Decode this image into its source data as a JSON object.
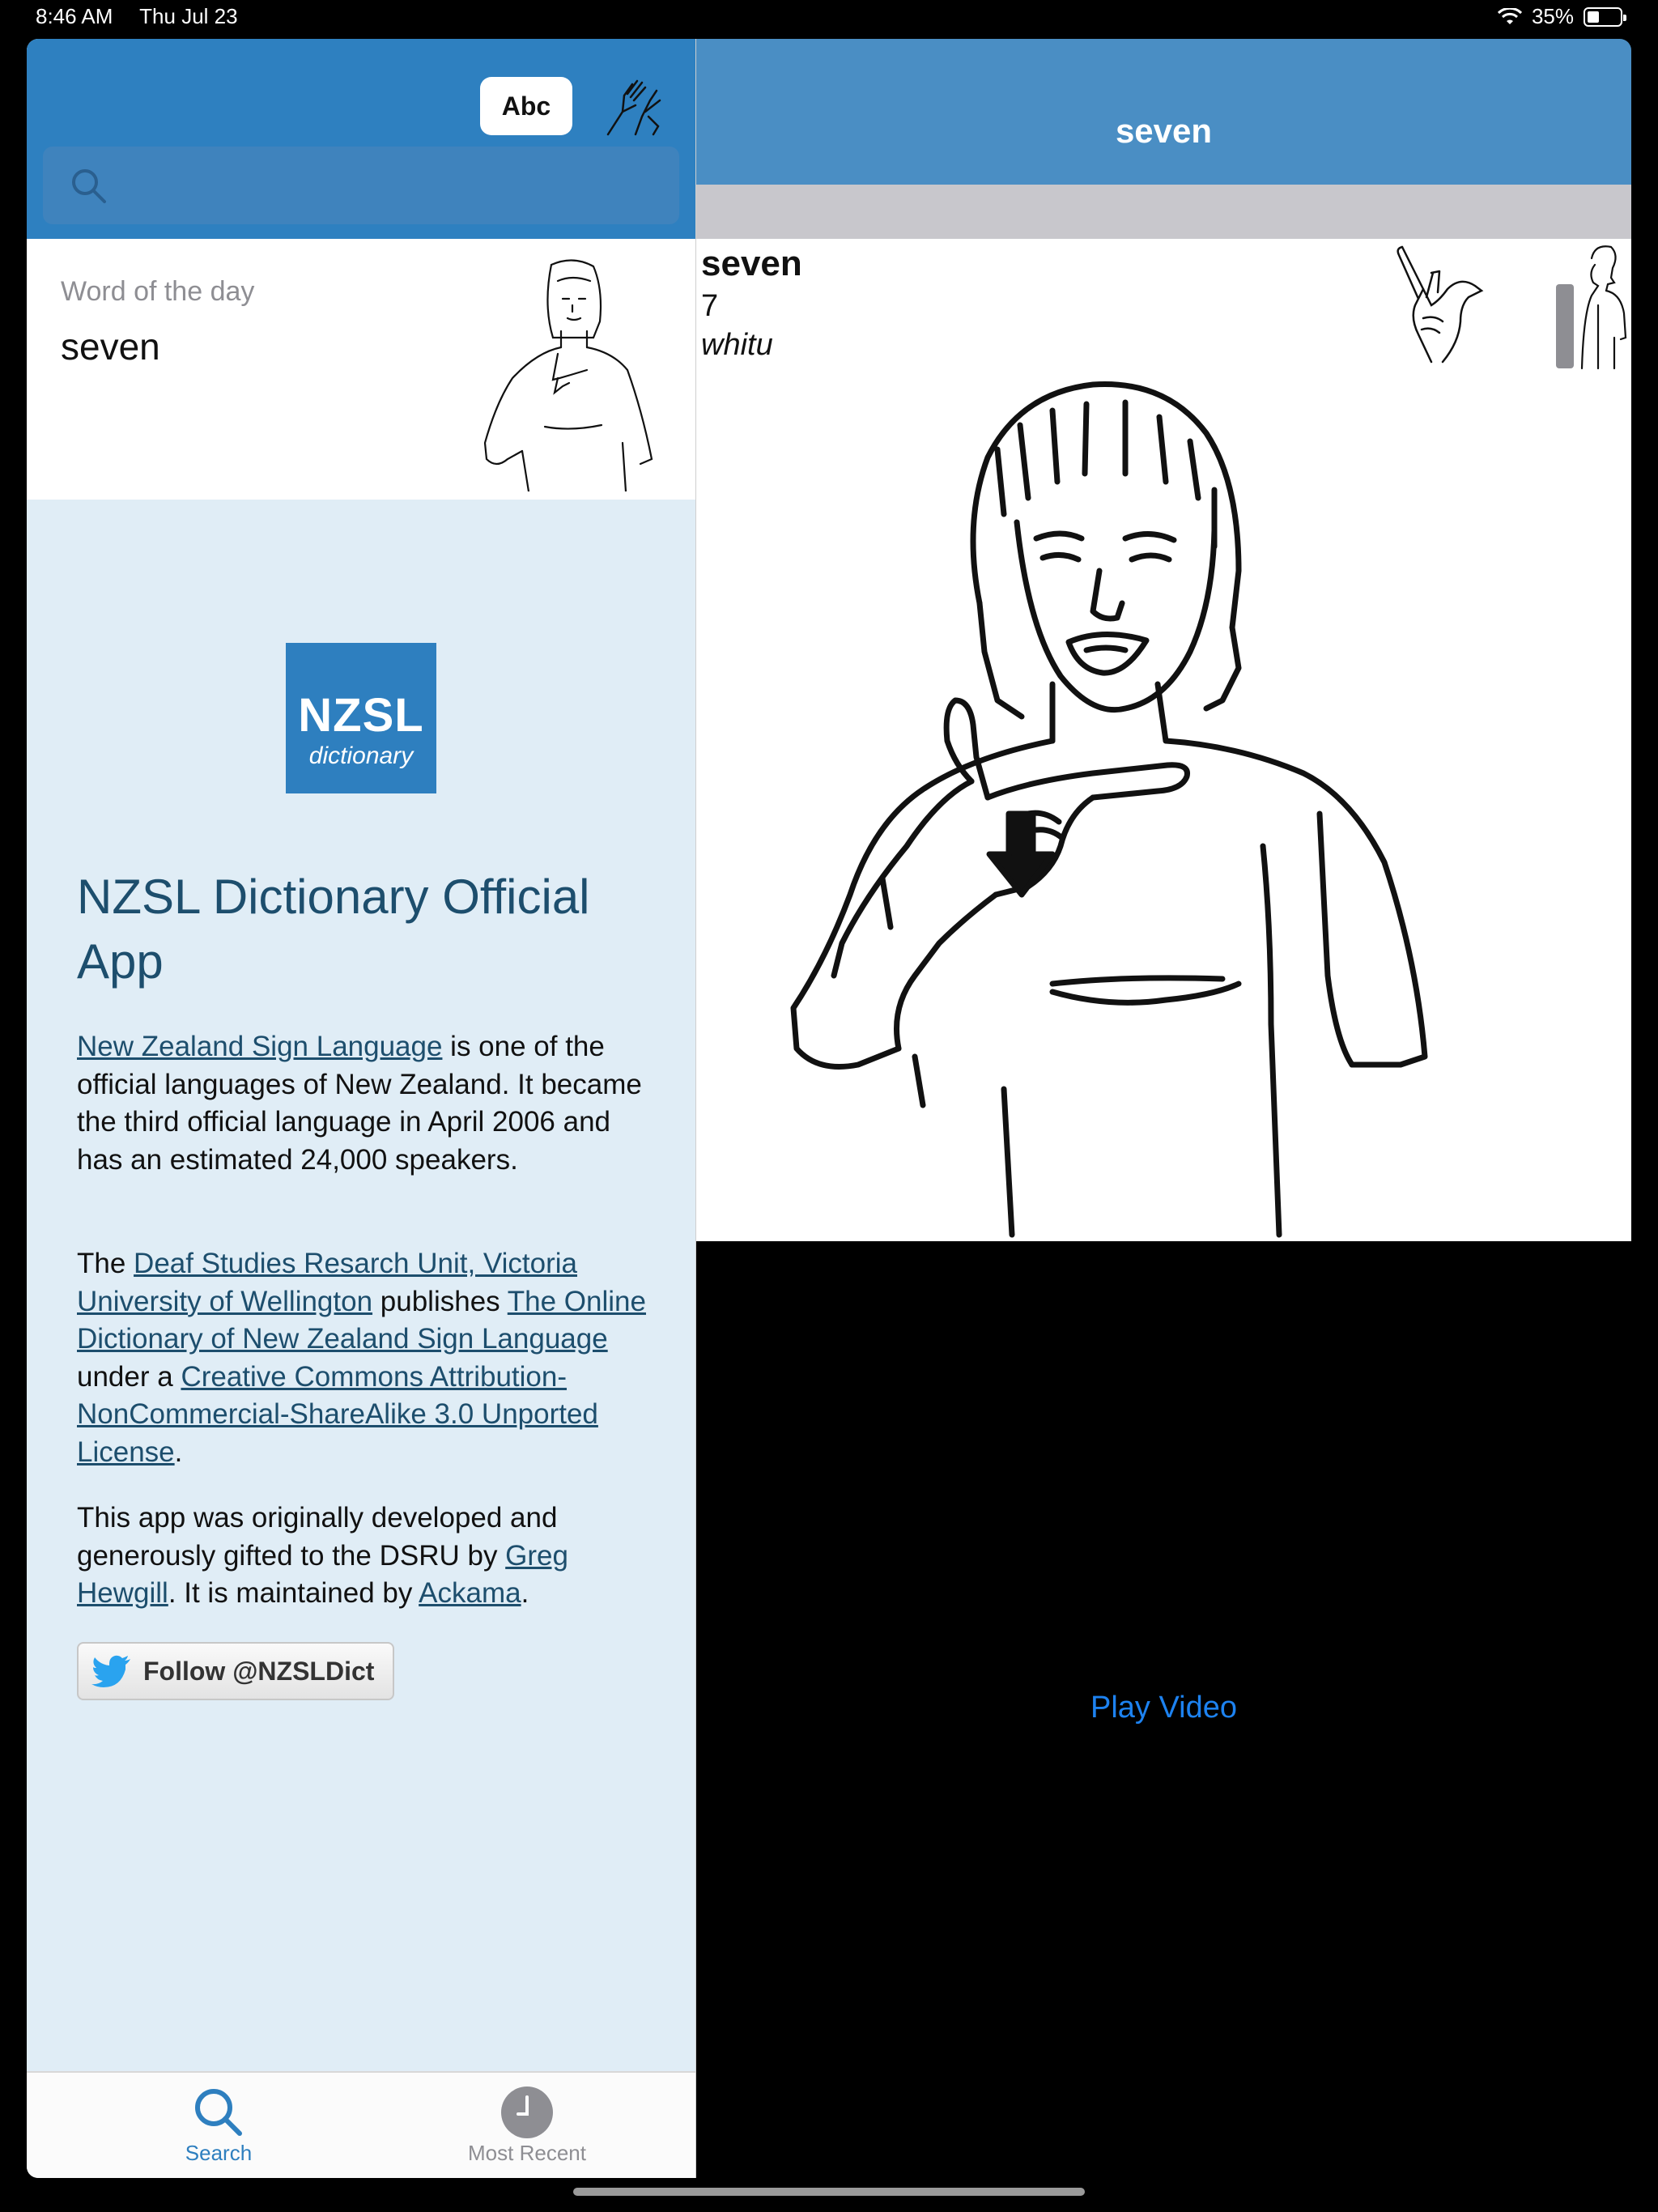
{
  "status": {
    "time": "8:46 AM",
    "date": "Thu Jul 23",
    "battery": "35%",
    "battery_level": 0.35
  },
  "left": {
    "abc_label": "Abc",
    "search_placeholder": "",
    "word_of_day_label": "Word of the day",
    "word_of_day": "seven",
    "logo_line1": "NZSL",
    "logo_line2": "dictionary",
    "app_title": "NZSL Dictionary Official App",
    "p1": {
      "link": "New Zealand Sign Language",
      "text": " is one of the official languages of New Zealand. It became the third official language in April 2006 and has an estimated 24,000 speakers."
    },
    "p2": {
      "t1": "The ",
      "link1": "Deaf Studies Resarch Unit, Victoria University of Wellington",
      "t2": " publishes ",
      "link2": "The Online Dictionary of New Zealand Sign Language",
      "t3": " under a ",
      "link3": "Creative Commons Attribution-NonCommercial-ShareAlike 3.0 Unported License",
      "t4": "."
    },
    "p3": {
      "t1": "This app was originally developed and generously gifted to the DSRU by ",
      "link1": "Greg Hewgill",
      "t2": ". It is maintained by ",
      "link2": "Ackama",
      "t3": "."
    },
    "follow_label": "Follow @NZSLDict",
    "tabs": [
      {
        "label": "Search",
        "icon": "search-icon"
      },
      {
        "label": "Most Recent",
        "icon": "clock-icon"
      }
    ]
  },
  "right": {
    "nav_title": "seven",
    "word": "seven",
    "number": "7",
    "maori": "whitu",
    "play_video": "Play Video"
  },
  "colors": {
    "header_blue": "#2e80c0",
    "right_nav_blue": "#4a8ec4",
    "link_blue": "#1d82f0",
    "panel_bg": "#e0edf6"
  }
}
